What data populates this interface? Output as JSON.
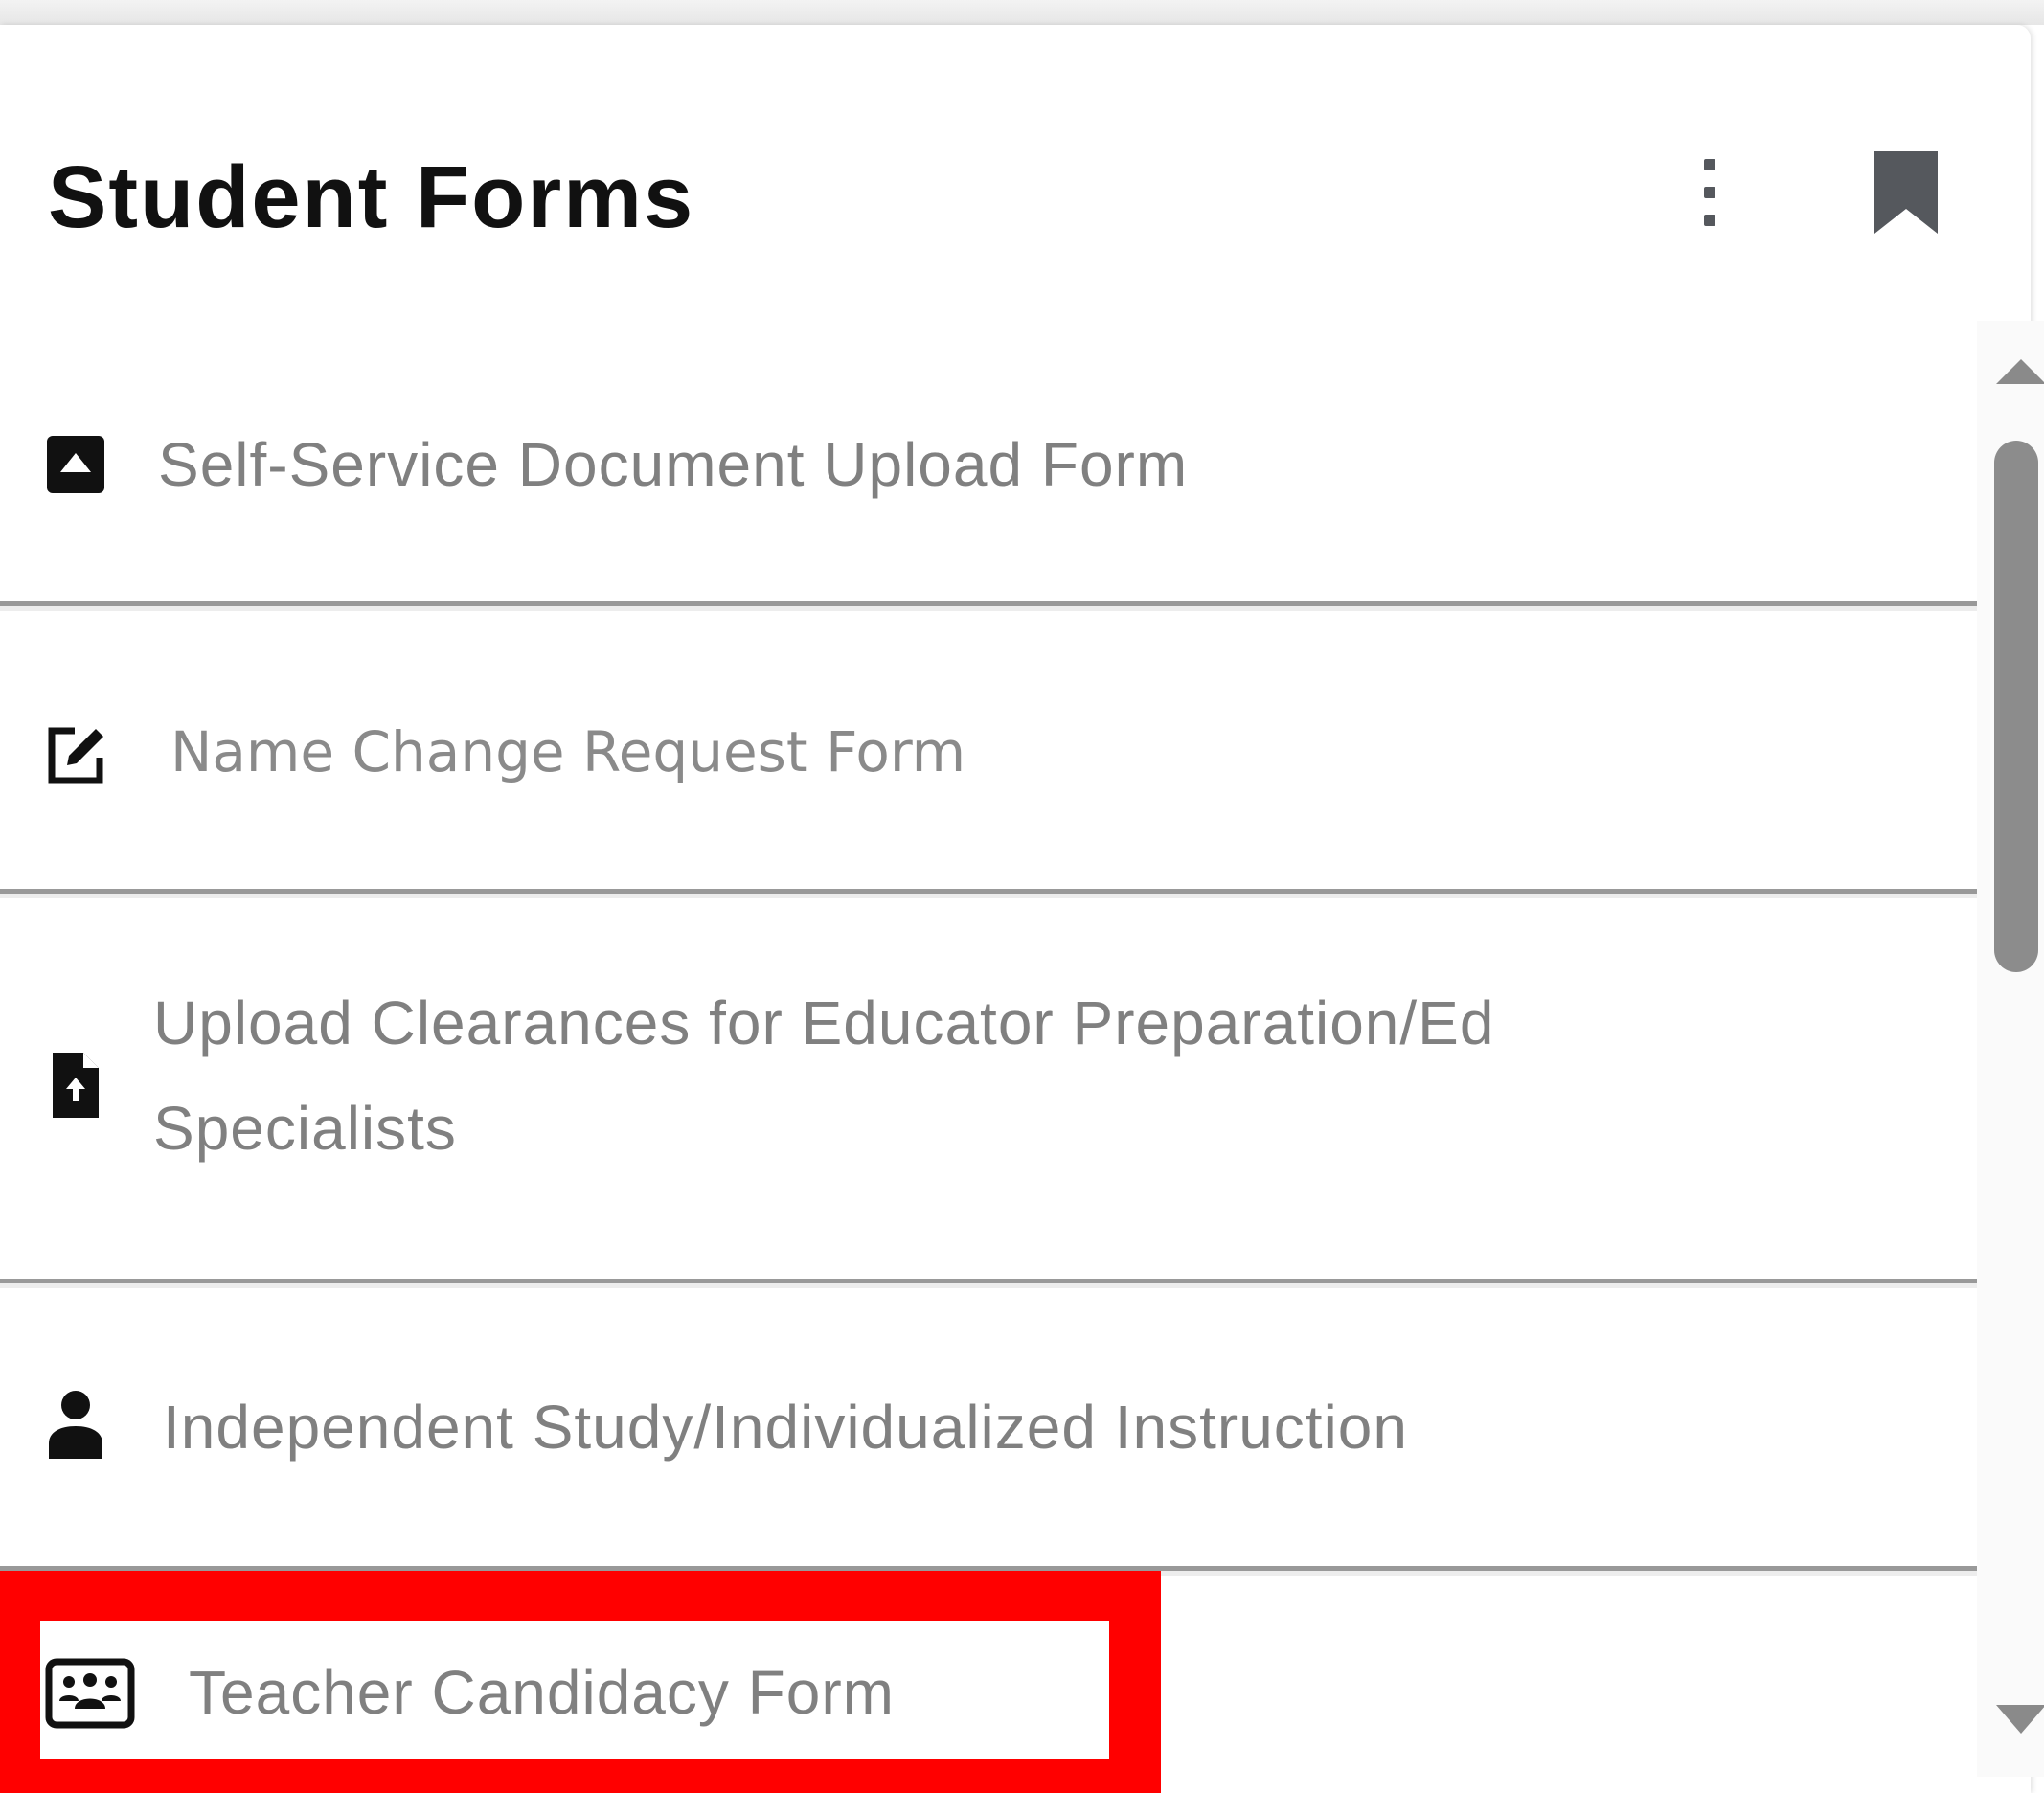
{
  "widget": {
    "title": "Student Forms",
    "menu_icon": "kebab-menu-icon",
    "bookmark_icon": "bookmark-icon"
  },
  "forms": [
    {
      "label": "Self-Service Document Upload Form",
      "icon": "upload-box-icon"
    },
    {
      "label": "Name Change Request Form",
      "icon": "edit-square-icon"
    },
    {
      "label": "Upload Clearances for Educator Preparation/Ed Specialists",
      "icon": "file-upload-icon"
    },
    {
      "label": "Independent Study/Individualized Instruction",
      "icon": "person-icon"
    },
    {
      "label": "Teacher Candidacy Form",
      "icon": "classroom-group-icon"
    }
  ],
  "highlight": {
    "color": "#ff0000",
    "target": "Teacher Candidacy Form"
  },
  "scrollbar": {
    "up_icon": "scroll-up-arrow-icon",
    "down_icon": "scroll-down-arrow-icon"
  }
}
